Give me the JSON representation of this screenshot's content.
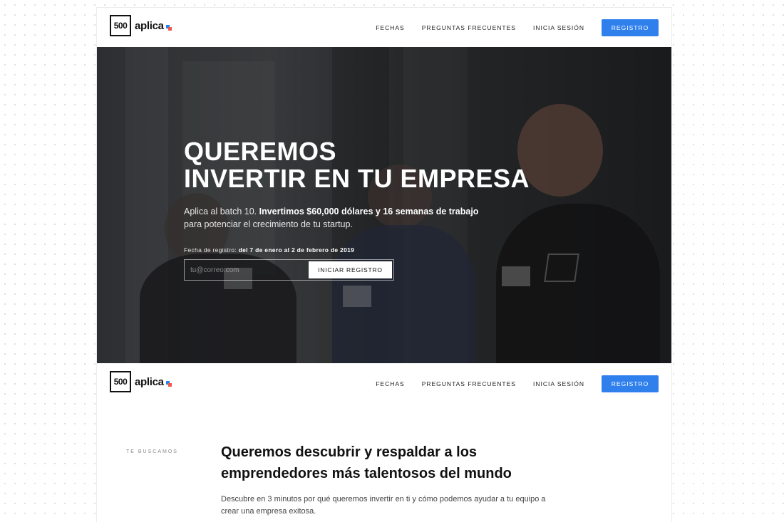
{
  "logo": {
    "number": "500",
    "name": "aplica"
  },
  "nav": {
    "links": [
      "FECHAS",
      "PREGUNTAS FRECUENTES",
      "INICIA SESIÓN"
    ],
    "cta": "REGISTRO"
  },
  "hero": {
    "title_line1": "QUEREMOS",
    "title_line2": "INVERTIR EN TU EMPRESA",
    "subtitle_prefix": "Aplica al batch 10. ",
    "subtitle_bold": "Invertimos $60,000 dólares y 16 semanas de trabajo",
    "subtitle_suffix": "para potenciar el crecimiento de tu startup.",
    "date_label": "Fecha de registro: ",
    "date_value": "del 7 de enero al 2 de febrero de 2019",
    "email_placeholder": "tu@correo.com",
    "button": "INICIAR REGISTRO"
  },
  "section": {
    "tag": "TE BUSCAMOS",
    "title": "Queremos descubrir y respaldar a los emprendedores más talentosos del mundo",
    "description": "Descubre en 3 minutos por qué queremos invertir en ti y cómo podemos ayudar a tu equipo a crear una empresa exitosa."
  },
  "colors": {
    "accent": "#2f80ed",
    "logo_blue": "#2f80ed",
    "logo_red": "#ee5a4a"
  }
}
